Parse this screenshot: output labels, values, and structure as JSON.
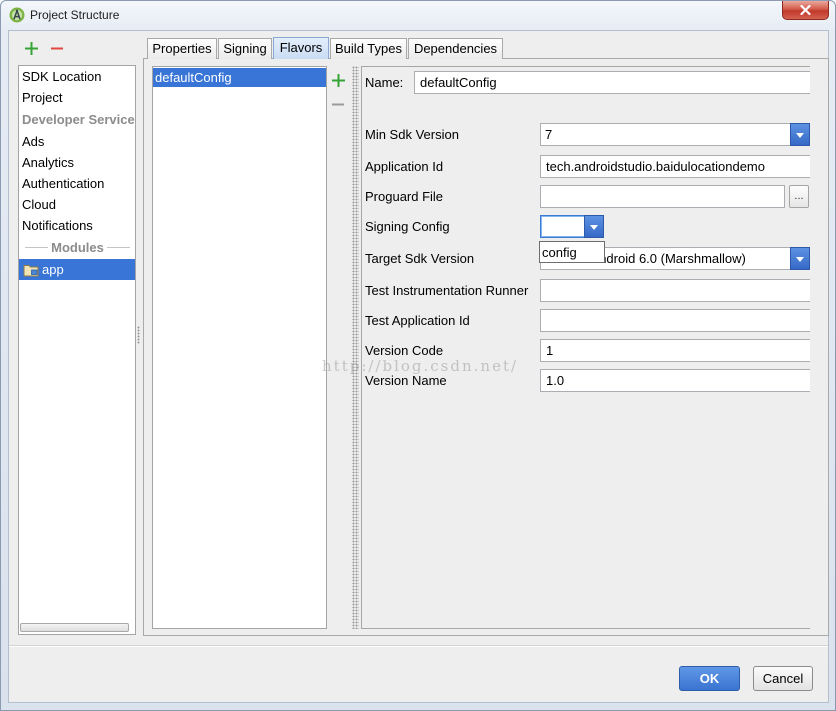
{
  "window": {
    "title": "Project Structure",
    "app_icon": "android-studio-icon",
    "close_icon": "close-icon"
  },
  "sidebar": {
    "add_icon": "plus-icon",
    "remove_icon": "minus-icon",
    "top_items": [
      "SDK Location",
      "Project"
    ],
    "developer_services_header": "Developer Services",
    "service_items": [
      "Ads",
      "Analytics",
      "Authentication",
      "Cloud",
      "Notifications"
    ],
    "modules_header": "Modules",
    "module_items": [
      {
        "label": "app",
        "icon": "module-folder-icon",
        "selected": true
      }
    ]
  },
  "tabs": [
    {
      "label": "Properties",
      "selected": false
    },
    {
      "label": "Signing",
      "selected": false
    },
    {
      "label": "Flavors",
      "selected": true
    },
    {
      "label": "Build Types",
      "selected": false
    },
    {
      "label": "Dependencies",
      "selected": false
    }
  ],
  "flavors": {
    "add_icon": "plus-icon",
    "remove_icon": "minus-icon",
    "items": [
      {
        "label": "defaultConfig",
        "selected": true
      }
    ]
  },
  "form": {
    "name": {
      "label": "Name:",
      "value": "defaultConfig"
    },
    "min_sdk_version": {
      "label": "Min Sdk Version",
      "value": "7",
      "dropdown_icon": "chevron-down-icon"
    },
    "application_id": {
      "label": "Application Id",
      "value": "tech.androidstudio.baidulocationdemo"
    },
    "proguard_file": {
      "label": "Proguard File",
      "value": "",
      "browse_label": "..."
    },
    "signing_config": {
      "label": "Signing Config",
      "value": "",
      "open": true,
      "options": [
        "config"
      ],
      "dropdown_icon": "chevron-down-icon"
    },
    "target_sdk_version": {
      "label": "Target Sdk Version",
      "value": "API 23: Android 6.0 (Marshmallow)",
      "dropdown_icon": "chevron-down-icon"
    },
    "test_instrumentation_runner": {
      "label": "Test Instrumentation Runner",
      "value": ""
    },
    "test_application_id": {
      "label": "Test Application Id",
      "value": ""
    },
    "version_code": {
      "label": "Version Code",
      "value": "1"
    },
    "version_name": {
      "label": "Version Name",
      "value": "1.0"
    }
  },
  "footer": {
    "ok_label": "OK",
    "cancel_label": "Cancel"
  },
  "watermark": "http://blog.csdn.net/",
  "colors": {
    "selection": "#3875d7",
    "add_icon": "#36a336",
    "remove_icon": "#e2473f",
    "remove_icon_disabled": "#9a9a9a",
    "primary_button": "#3a74d1",
    "close_button": "#c0392b"
  }
}
